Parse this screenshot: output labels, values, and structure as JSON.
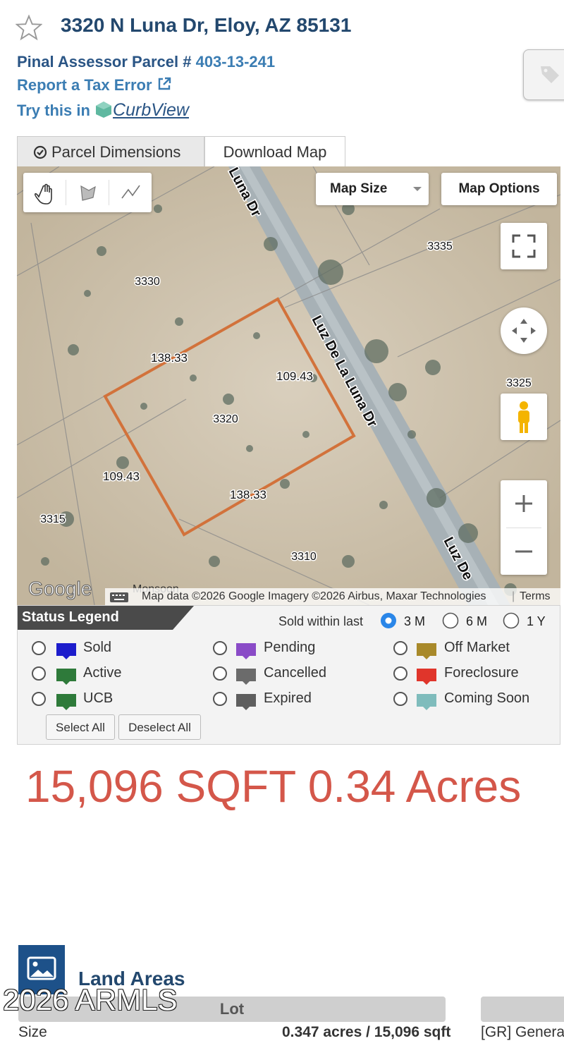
{
  "header": {
    "address": "3320 N Luna Dr, Eloy, AZ 85131",
    "parcel_prefix": "Pinal Assessor Parcel #",
    "parcel_number": "403-13-241",
    "tax_error_label": "Report a Tax Error",
    "try_label": "Try this in",
    "curbview_label": "CurbView"
  },
  "tabs": [
    {
      "label": "Parcel Dimensions",
      "active": true
    },
    {
      "label": "Download Map",
      "active": false
    }
  ],
  "map": {
    "map_size_label": "Map Size",
    "map_options_label": "Map Options",
    "streets": [
      "Luna Dr",
      "Luz De La Luna Dr",
      "Luz De"
    ],
    "parcels": [
      "3330",
      "3335",
      "3325",
      "3320",
      "3315",
      "3310"
    ],
    "dimensions": [
      "138.33",
      "109.43",
      "109.43",
      "138.33"
    ],
    "google_logo": "Google",
    "partial_label": "Monsoon",
    "attribution": "Map data ©2026 Google Imagery ©2026 Airbus, Maxar Technologies",
    "terms": "Terms",
    "parcel_outline_color": "#d2723b"
  },
  "legend": {
    "title": "Status Legend",
    "sold_within_label": "Sold within last",
    "periods": [
      {
        "label": "3 M",
        "selected": true
      },
      {
        "label": "6 M",
        "selected": false
      },
      {
        "label": "1 Y",
        "selected": false
      }
    ],
    "items": [
      {
        "label": "Sold",
        "color": "#1d1dcc"
      },
      {
        "label": "Pending",
        "color": "#8a4bc7"
      },
      {
        "label": "Off Market",
        "color": "#a8892a"
      },
      {
        "label": "Active",
        "color": "#2e7a3a"
      },
      {
        "label": "Cancelled",
        "color": "#6b6b6b"
      },
      {
        "label": "Foreclosure",
        "color": "#e0352b"
      },
      {
        "label": "UCB",
        "color": "#2e7a3a"
      },
      {
        "label": "Expired",
        "color": "#5e5e5e"
      },
      {
        "label": "Coming Soon",
        "color": "#7fbcbc"
      }
    ],
    "select_all": "Select All",
    "deselect_all": "Deselect All"
  },
  "summary": {
    "area_text": "15,096 SQFT 0.34 Acres"
  },
  "land_areas": {
    "title": "Land Areas",
    "watermark": "2026 ARMLS",
    "column": "Lot",
    "size_label": "Size",
    "size_value": "0.347 acres / 15,096 sqft",
    "zoning_value": "[GR] Genera"
  }
}
